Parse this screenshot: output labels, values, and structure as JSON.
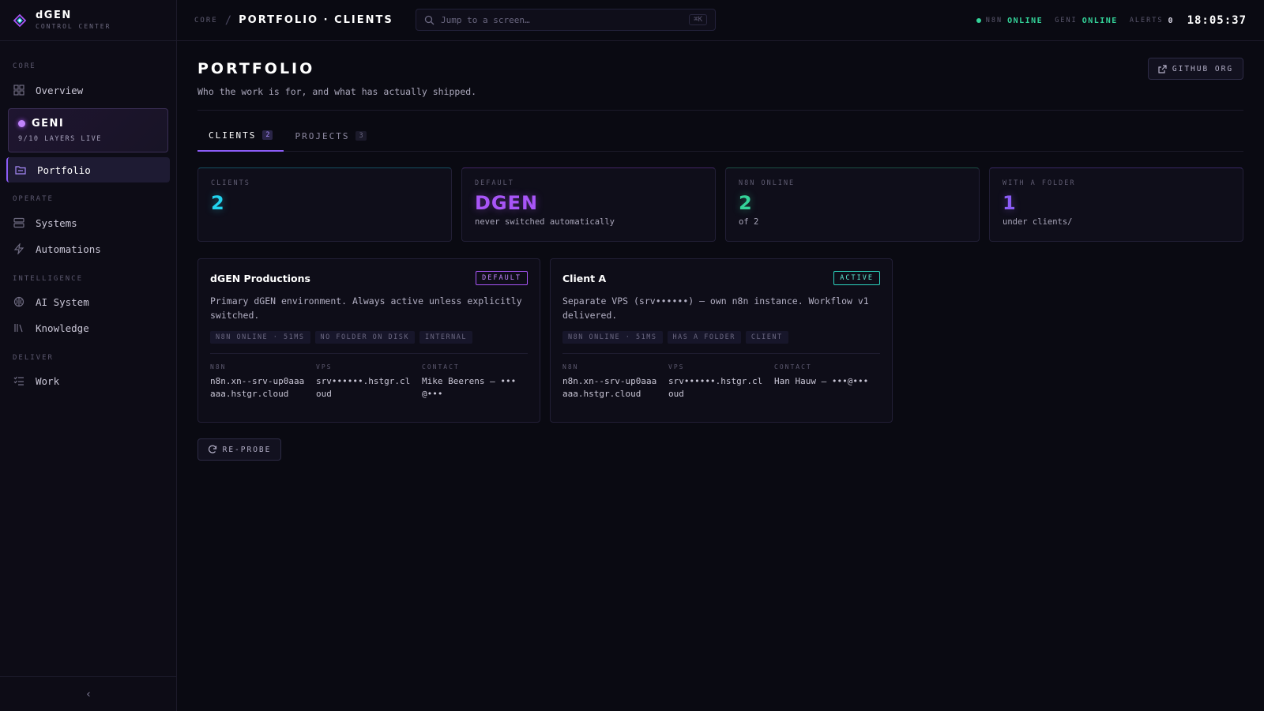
{
  "brand": {
    "name": "dGEN",
    "subtitle": "CONTROL CENTER"
  },
  "sidebar": {
    "sections": [
      "CORE",
      "OPERATE",
      "INTELLIGENCE",
      "DELIVER"
    ],
    "overview": "Overview",
    "geni": {
      "title": "GENI",
      "status": "9/10 LAYERS LIVE"
    },
    "portfolio": "Portfolio",
    "systems": "Systems",
    "automations": "Automations",
    "ai_system": "AI System",
    "knowledge": "Knowledge",
    "work": "Work",
    "collapse": "‹"
  },
  "topbar": {
    "crumb_root": "CORE",
    "crumb_sep": "/",
    "crumb_current": "PORTFOLIO · CLIENTS",
    "search_placeholder": "Jump to a screen…",
    "search_shortcut": "⌘K",
    "n8n_label": "N8N",
    "n8n_status": "ONLINE",
    "geni_label": "GENI",
    "geni_status": "ONLINE",
    "alerts_label": "ALERTS",
    "alerts_count": "0",
    "clock": "18:05:37"
  },
  "page": {
    "title": "PORTFOLIO",
    "subtitle": "Who the work is for, and what has actually shipped.",
    "github_button": "GITHUB ORG",
    "tabs": [
      {
        "label": "CLIENTS",
        "count": "2"
      },
      {
        "label": "PROJECTS",
        "count": "3"
      }
    ]
  },
  "stats": [
    {
      "label": "CLIENTS",
      "value": "2",
      "foot": "",
      "color": "#22d3ee"
    },
    {
      "label": "DEFAULT",
      "value": "DGEN",
      "foot": "never switched automatically",
      "color": "#a855f7"
    },
    {
      "label": "N8N ONLINE",
      "value": "2",
      "foot": "of 2",
      "color": "#34d399"
    },
    {
      "label": "WITH A FOLDER",
      "value": "1",
      "foot": "under clients/",
      "color": "#8b5cf6"
    }
  ],
  "clients": [
    {
      "name": "dGEN Productions",
      "badge": "DEFAULT",
      "description": "Primary dGEN environment. Always active unless explicitly switched.",
      "tags": [
        "N8N ONLINE · 51MS",
        "NO FOLDER ON DISK",
        "INTERNAL"
      ],
      "fields": [
        {
          "label": "N8N",
          "value": "n8n.xn--srv-up0aaaaaa.hstgr.cloud"
        },
        {
          "label": "VPS",
          "value": "srv••••••.hstgr.cloud"
        },
        {
          "label": "CONTACT",
          "value": "Mike Beerens — •••@•••"
        }
      ]
    },
    {
      "name": "Client A",
      "badge": "ACTIVE",
      "description": "Separate VPS (srv••••••) — own n8n instance. Workflow v1 delivered.",
      "tags": [
        "N8N ONLINE · 51MS",
        "HAS A FOLDER",
        "CLIENT"
      ],
      "fields": [
        {
          "label": "N8N",
          "value": "n8n.xn--srv-up0aaaaaa.hstgr.cloud"
        },
        {
          "label": "VPS",
          "value": "srv••••••.hstgr.cloud"
        },
        {
          "label": "CONTACT",
          "value": "Han Hauw — •••@•••"
        }
      ]
    }
  ],
  "reprobe_button": "RE-PROBE",
  "colors": {
    "accent": "#8b5cf6",
    "online": "#34d399",
    "cyan": "#22d3ee",
    "purple": "#a855f7"
  },
  "icons": [
    "logo-icon",
    "grid-icon",
    "folder-icon",
    "server-icon",
    "bolt-icon",
    "brain-icon",
    "library-icon",
    "list-icon",
    "search-icon",
    "external-link-icon",
    "refresh-icon",
    "chevron-left-icon"
  ]
}
